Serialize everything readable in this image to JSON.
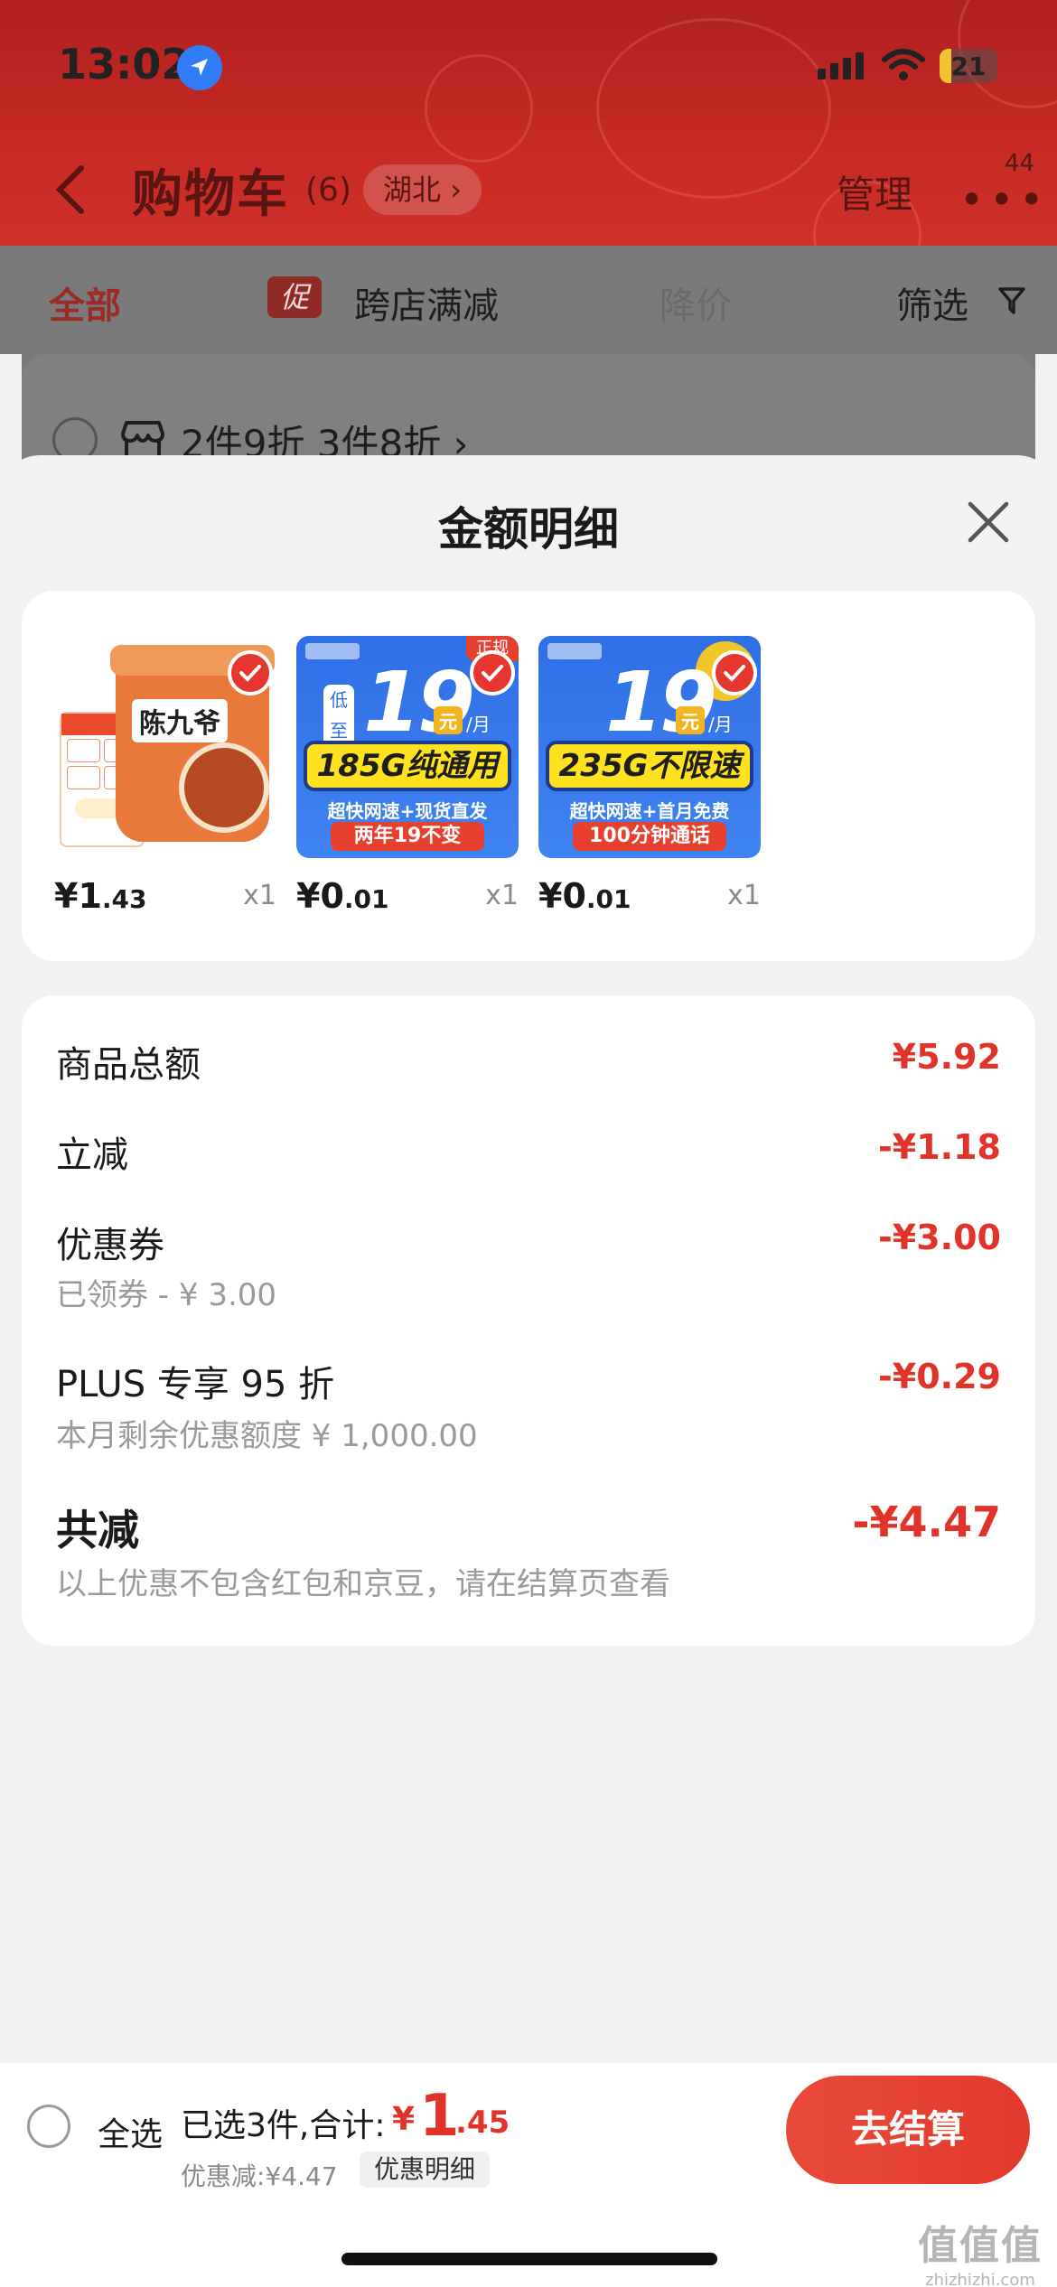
{
  "status_bar": {
    "time": "13:02",
    "battery": "21",
    "battery_level": 0.21
  },
  "nav": {
    "title": "购物车",
    "count": "(6)",
    "region": "湖北",
    "manage": "管理",
    "badge": "44"
  },
  "filters": {
    "all": "全部",
    "promo_tag": "促",
    "cross_store": "跨店满减",
    "price_drop": "降价",
    "filter": "筛选"
  },
  "store_promo": "2件9折 3件8折",
  "sheet": {
    "title": "金额明细",
    "products": [
      {
        "name": "陈九爷",
        "price_int": "¥1",
        "price_dec": ".43",
        "qty": "x1"
      },
      {
        "big": "19",
        "unit": "元",
        "unit2": "/月",
        "low": "低至",
        "tag": "正规",
        "banner": "185G纯通用",
        "sub": "超快网速+现货直发",
        "pill": "两年19不变",
        "price_int": "¥0",
        "price_dec": ".01",
        "qty": "x1"
      },
      {
        "big": "19",
        "unit": "元",
        "unit2": "/月",
        "banner": "235G不限速",
        "sub": "超快网速+首月免费",
        "pill": "100分钟通话",
        "price_int": "¥0",
        "price_dec": ".01",
        "qty": "x1"
      }
    ],
    "rows": {
      "goods_total": {
        "label": "商品总额",
        "value": "¥5.92"
      },
      "instant": {
        "label": "立减",
        "value": "-¥1.18"
      },
      "coupon": {
        "label": "优惠券",
        "value": "-¥3.00",
        "sub": "已领券 - ¥ 3.00"
      },
      "plus": {
        "label": "PLUS 专享 95 折",
        "value": "-¥0.29",
        "sub": "本月剩余优惠额度 ¥ 1,000.00"
      },
      "total": {
        "label": "共减",
        "value": "-¥4.47",
        "sub": "以上优惠不包含红包和京豆，请在结算页查看"
      }
    }
  },
  "bottom": {
    "select_all": "全选",
    "summary": "已选3件,合计:",
    "yen": "¥",
    "amount_int": "1",
    "amount_dec": ".45",
    "discount": "优惠减:¥4.47",
    "detail": "优惠明细",
    "checkout": "去结算"
  },
  "watermark": {
    "logo": "值值值",
    "url": "zhizhizhi.com"
  }
}
